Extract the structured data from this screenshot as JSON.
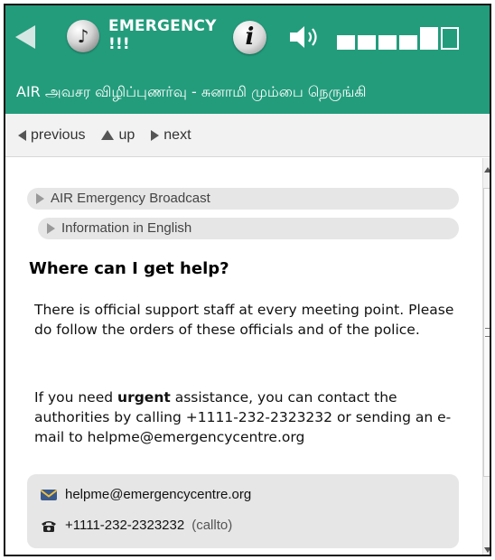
{
  "header": {
    "title_line1": "EMERGENCY",
    "title_line2": "!!!",
    "info_glyph": "i",
    "volume_level": 5,
    "volume_max": 6,
    "icons": [
      "back-arrow-icon",
      "radio-ball-icon",
      "info-icon",
      "speaker-icon"
    ]
  },
  "subtitle": "AIR அவசர விழிப்புணர்வு - சுனாமி மும்பை நெருங்கி",
  "nav": {
    "previous": "previous",
    "up": "up",
    "next": "next"
  },
  "breadcrumbs": [
    {
      "label": "AIR Emergency Broadcast"
    },
    {
      "label": "Information in English"
    }
  ],
  "section": {
    "heading": "Where can I get help?",
    "p1": "There is official support staff at every meeting point. Please do follow the orders of these officials and of the police.",
    "p2_before": "If you need ",
    "p2_strong": "urgent",
    "p2_after": " assistance, you can contact the authorities by calling +1111-232-2323232 or sending an e-mail to helpme@emergencycentre.org"
  },
  "contact": {
    "email": "helpme@emergencycentre.org",
    "phone": "+1111-232-2323232",
    "phone_note": "(callto)"
  },
  "colors": {
    "accent_green": "#239c7c",
    "panel_gray": "#e6e6e6"
  }
}
